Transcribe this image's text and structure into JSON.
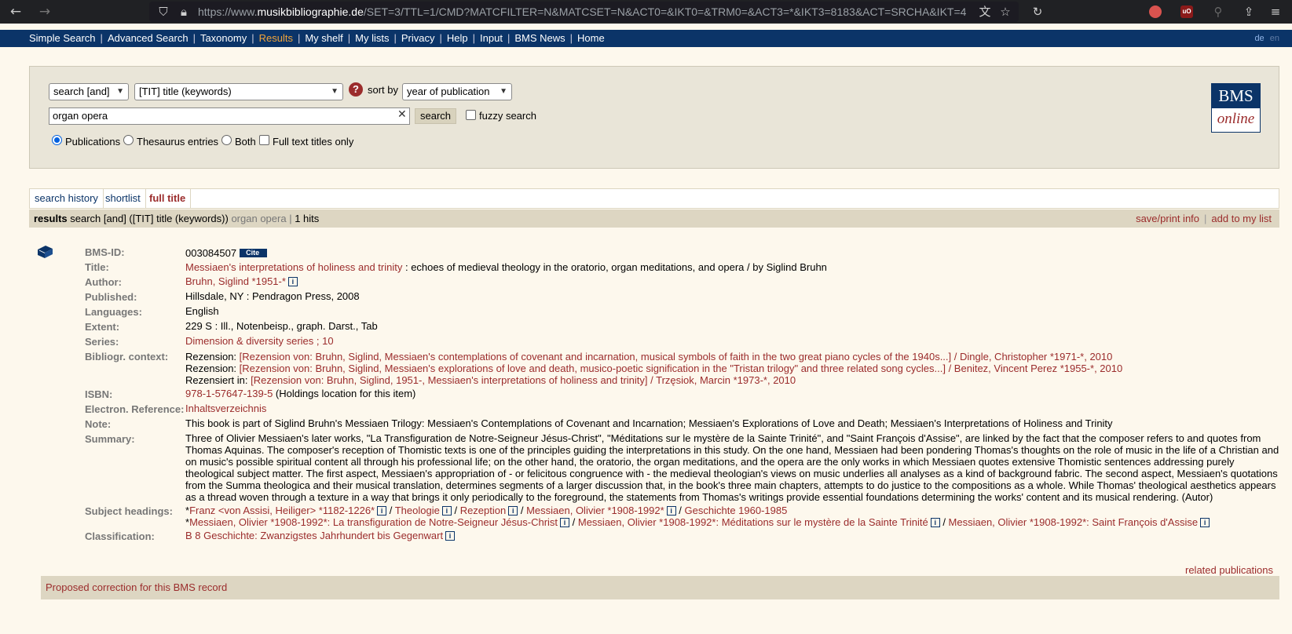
{
  "browser": {
    "url_prefix": "https://www.",
    "url_domain": "musikbibliographie.de",
    "url_rest": "/SET=3/TTL=1/CMD?MATCFILTER=N&MATCSET=N&ACT0=&IKT0=&TRM0=&ACT3=*&IKT3=8183&ACT=SRCHA&IKT=4"
  },
  "topnav": {
    "items": [
      "Simple Search",
      "Advanced Search",
      "Taxonomy",
      "Results",
      "My shelf",
      "My lists",
      "Privacy",
      "Help",
      "Input",
      "BMS News",
      "Home"
    ],
    "active": "Results",
    "lang_de": "de",
    "lang_en": "en"
  },
  "search": {
    "operator": "search [and]",
    "field": "[TIT] title (keywords)",
    "help": "?",
    "sort_label": "sort by",
    "sort_value": "year of publication",
    "query": "organ opera",
    "clear": "✕",
    "button": "search",
    "fuzzy_label": "fuzzy search",
    "fuzzy_checked": false,
    "scope_options": [
      "Publications",
      "Thesaurus entries",
      "Both"
    ],
    "scope_selected": "Publications",
    "fulltext_label": "Full text titles only"
  },
  "logo": {
    "top": "BMS",
    "bottom": "online"
  },
  "tabs": [
    "search history",
    "shortlist",
    "full title"
  ],
  "active_tab": "full title",
  "results": {
    "label": "results",
    "query_desc": "search [and] ([TIT] title (keywords))",
    "query_term": "organ opera",
    "hits": "1 hits",
    "save_print": "save/print info",
    "add_list": "add to my list"
  },
  "record": {
    "labels": {
      "bms_id": "BMS-ID:",
      "title": "Title:",
      "author": "Author:",
      "published": "Published:",
      "languages": "Languages:",
      "extent": "Extent:",
      "series": "Series:",
      "context": "Bibliogr. context:",
      "isbn": "ISBN:",
      "eref": "Electron. Reference:",
      "note": "Note:",
      "summary": "Summary:",
      "subjects": "Subject headings:",
      "classification": "Classification:"
    },
    "bms_id": "003084507",
    "cite": "Cite",
    "title_link": "Messiaen's interpretations of holiness and trinity",
    "title_rest": " : echoes of medieval theology in the oratorio, organ meditations, and opera / by Siglind Bruhn",
    "author": "Bruhn, Siglind *1951-*",
    "published": "Hillsdale, NY : Pendragon Press, 2008",
    "languages": "English",
    "extent": "229 S : Ill., Notenbeisp., graph. Darst., Tab",
    "series": "Dimension & diversity series ; 10",
    "context": [
      {
        "prefix": "Rezension: ",
        "link": "[Rezension von: Bruhn, Siglind, Messiaen's contemplations of covenant and incarnation, musical symbols of faith in the two great piano cycles of the 1940s...] / Dingle, Christopher *1971-*, 2010"
      },
      {
        "prefix": "Rezension: ",
        "link": "[Rezension von: Bruhn, Siglind, Messiaen's explorations of love and death, musico-poetic signification in the \"Tristan trilogy\" and three related song cycles...] / Benitez, Vincent Perez *1955-*, 2010"
      },
      {
        "prefix": "Rezensiert in: ",
        "link": "[Rezension von: Bruhn, Siglind, 1951-, Messiaen's interpretations of holiness and trinity] / Trzęsiok, Marcin *1973-*, 2010"
      }
    ],
    "isbn": "978-1-57647-139-5",
    "isbn_holdings": " (Holdings location for this item)",
    "eref": "Inhaltsverzeichnis",
    "note": "This book is part of Siglind Bruhn's Messiaen Trilogy: Messiaen's Contemplations of Covenant and Incarnation; Messiaen's Explorations of Love and Death; Messiaen's Interpretations of Holiness and Trinity",
    "summary": "Three of Olivier Messiaen's later works, \"La Transfiguration de Notre-Seigneur Jésus-Christ\", \"Méditations sur le mystère de la Sainte Trinité\", and \"Saint François d'Assise\", are linked by the fact that the composer refers to and quotes from Thomas Aquinas. The composer's reception of Thomistic texts is one of the principles guiding the interpretations in this study. On the one hand, Messiaen had been pondering Thomas's thoughts on the role of music in the life of a Christian and on music's possible spiritual content all through his professional life; on the other hand, the oratorio, the organ meditations, and the opera are the only works in which Messiaen quotes extensive Thomistic sentences addressing purely theological subject matter. The first aspect, Messiaen's appropriation of - or felicitous congruence with - the medieval theologian's views on music underlies all analyses as a kind of background fabric. The second aspect, Messiaen's quotations from the Summa theologica and their musical translation, determines segments of a larger discussion that, in the book's three main chapters, attempts to do justice to the compositions as a whole. While Thomas' theological aesthetics appears as a thread woven through a texture in a way that brings it only periodically to the foreground, the statements from Thomas's writings provide essential foundations determining the works' content and its musical rendering. (Autor)",
    "subjects_line1": [
      "Franz <von Assisi, Heiliger> *1182-1226*",
      "Theologie",
      "Rezeption",
      "Messiaen, Olivier *1908-1992*",
      "Geschichte 1960-1985"
    ],
    "subjects_line2": [
      "Messiaen, Olivier *1908-1992*: La transfiguration de Notre-Seigneur Jésus-Christ",
      "Messiaen, Olivier *1908-1992*: Méditations sur le mystère de la Sainte Trinité",
      "Messiaen, Olivier *1908-1992*: Saint François d'Assise"
    ],
    "classification": "B 8 Geschichte: Zwanzigstes Jahrhundert bis Gegenwart",
    "info": "i",
    "star": "*",
    "slash": " / "
  },
  "footer": {
    "related": "related publications",
    "correction": "Proposed correction for this BMS record"
  }
}
